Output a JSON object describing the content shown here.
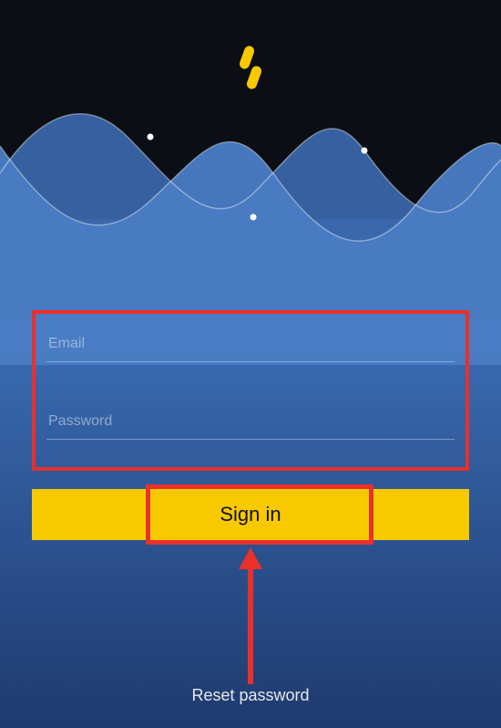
{
  "colors": {
    "accent": "#f9c900",
    "highlight": "#e9302a",
    "wave": "#4a7cc4"
  },
  "logo": {
    "name": "app-logo"
  },
  "form": {
    "email": {
      "placeholder": "Email",
      "value": ""
    },
    "password": {
      "placeholder": "Password",
      "value": ""
    }
  },
  "buttons": {
    "signin_label": "Sign in"
  },
  "links": {
    "reset_label": "Reset password"
  }
}
